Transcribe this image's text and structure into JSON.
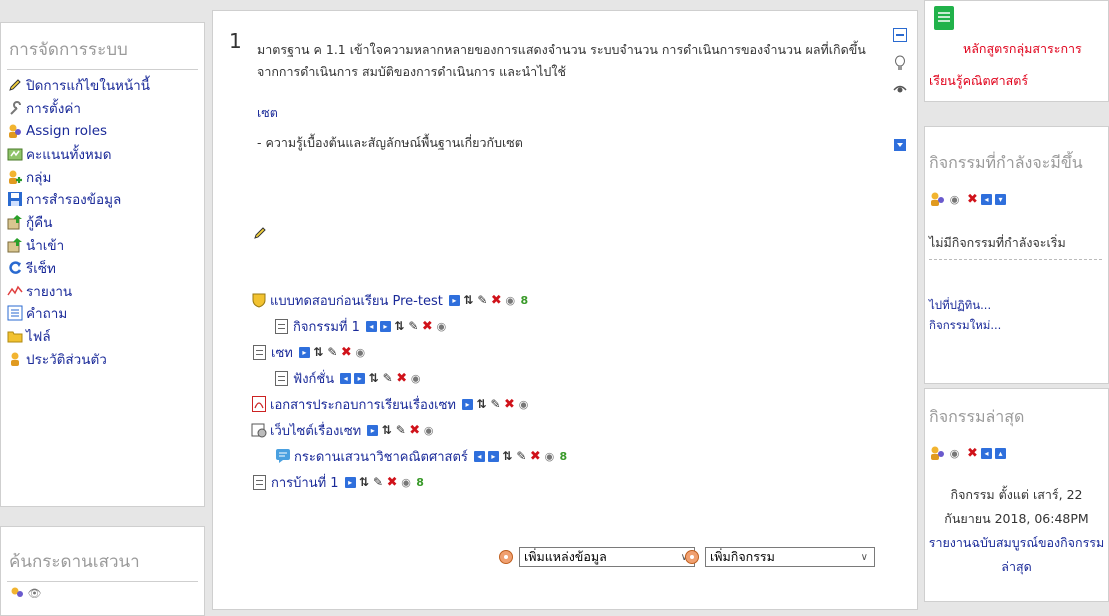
{
  "admin": {
    "title": "การจัดการระบบ",
    "items": [
      {
        "label": "ปิดการแก้ไขในหน้านี้",
        "icon": "pencil-icon"
      },
      {
        "label": "การตั้งค่า",
        "icon": "wrench-icon"
      },
      {
        "label": "Assign roles",
        "icon": "roles-icon"
      },
      {
        "label": "คะแนนทั้งหมด",
        "icon": "grades-icon"
      },
      {
        "label": "กลุ่ม",
        "icon": "groups-icon"
      },
      {
        "label": "การสำรองข้อมูล",
        "icon": "save-icon"
      },
      {
        "label": "กู้คืน",
        "icon": "restore-icon"
      },
      {
        "label": "นำเข้า",
        "icon": "import-icon"
      },
      {
        "label": "รีเซ็ท",
        "icon": "reset-icon"
      },
      {
        "label": "รายงาน",
        "icon": "report-icon"
      },
      {
        "label": "คำถาม",
        "icon": "questions-icon"
      },
      {
        "label": "ไฟล์",
        "icon": "folder-icon"
      },
      {
        "label": "ประวัติส่วนตัว",
        "icon": "profile-icon"
      }
    ]
  },
  "forum_search": {
    "title": "ค้นกระดานเสวนา"
  },
  "section": {
    "number": "1",
    "summary": "มาตรฐาน ค 1.1 เข้าใจความหลากหลายของการแสดงจำนวน ระบบจำนวน การดำเนินการของจำนวน ผลที่เกิดขึ้นจากการดำเนินการ สมบัติของการดำเนินการ และนำไปใช้",
    "link": "เซต",
    "desc": "- ความรู้เบื้องต้นและสัญลักษณ์พื้นฐานเกี่ยวกับเซต",
    "activities": [
      {
        "label": "แบบทดสอบก่อนเรียน Pre-test",
        "icon": "quiz-icon"
      },
      {
        "label": "กิจกรรมที่ 1",
        "icon": "page-icon"
      },
      {
        "label": "เซท",
        "icon": "page-icon"
      },
      {
        "label": "ฟังก์ชั่น",
        "icon": "page-icon"
      },
      {
        "label": "เอกสารประกอบการเรียนเรื่องเซท",
        "icon": "pdf-icon"
      },
      {
        "label": "เว็บไซต์เรื่องเซท",
        "icon": "website-icon"
      },
      {
        "label": "กระดานเสวนาวิชาคณิตศาสตร์",
        "icon": "forum-icon"
      },
      {
        "label": "การบ้านที่ 1",
        "icon": "assignment-icon"
      }
    ],
    "add_resource": "เพิ่มแหล่งข้อมูล",
    "add_activity": "เพิ่มกิจกรรม"
  },
  "curriculum": {
    "line1": "หลักสูตรกลุ่มสาระการ",
    "line2": "เรียนรู้คณิตศาสตร์"
  },
  "upcoming": {
    "title": "กิจกรรมที่กำลังจะมีขึ้น",
    "empty": "ไม่มีกิจกรรมที่กำลังจะเริ่ม",
    "calendar_link": "ไปที่ปฏิทิน...",
    "new_event_link": "กิจกรรมใหม่..."
  },
  "recent": {
    "title": "กิจกรรมล่าสุด",
    "since_line1": "กิจกรรม ตั้งแต่ เสาร์, 22",
    "since_line2": "กันยายน 2018, 06:48PM",
    "report_line1": "รายงานฉบับสมบูรณ์ของกิจกรรม",
    "report_line2": "ล่าสุด"
  },
  "colors": {
    "link": "#1a2a99",
    "red_link": "#e0001a",
    "title_gray": "#9a9a9a"
  }
}
